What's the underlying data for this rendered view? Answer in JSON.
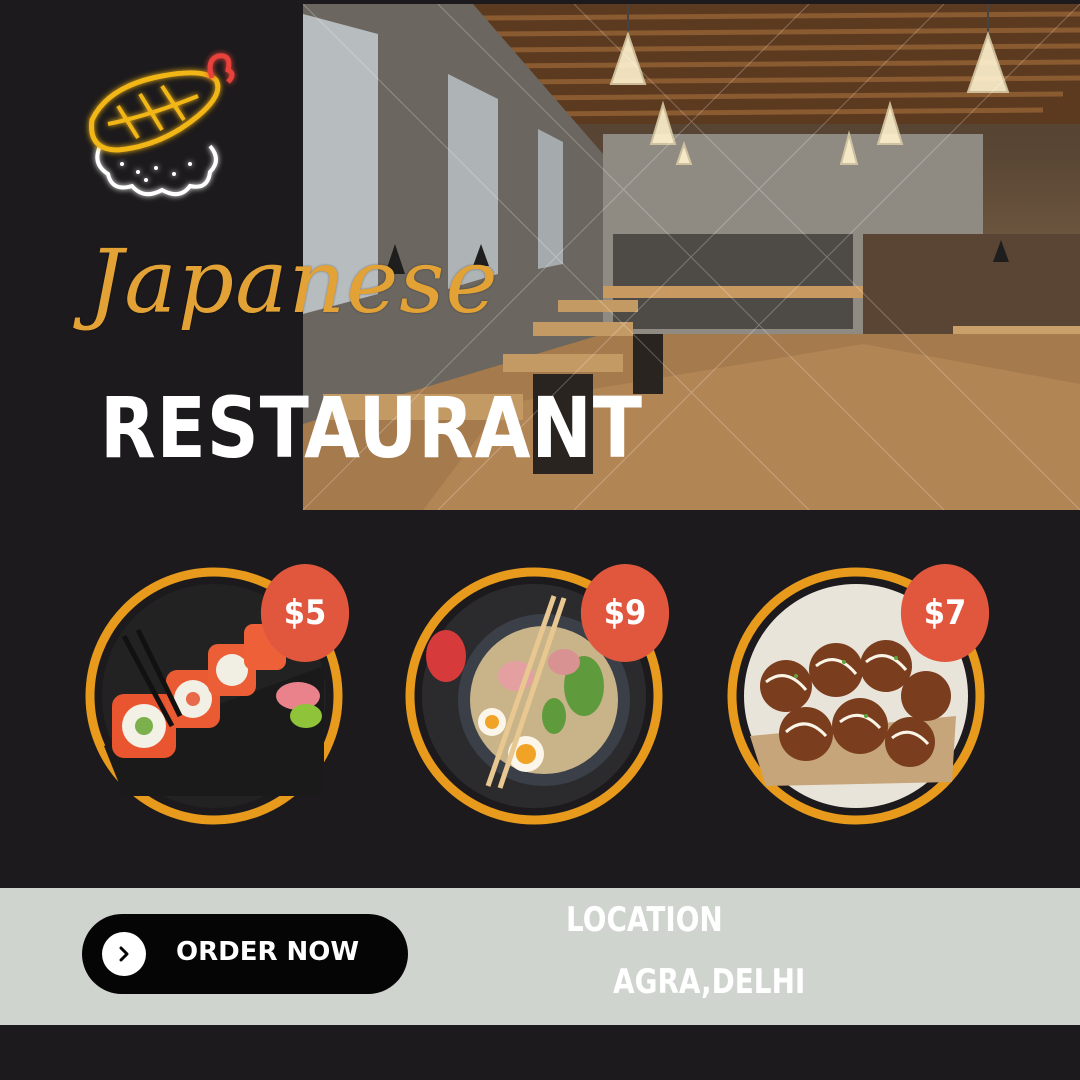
{
  "brand": {
    "title_script": "Japanese",
    "title_main": "RESTAURANT"
  },
  "dishes": [
    {
      "price": "$5",
      "icon": "sushi-roll-photo"
    },
    {
      "price": "$9",
      "icon": "ramen-bowl-photo"
    },
    {
      "price": "$7",
      "icon": "takoyaki-photo"
    }
  ],
  "cta": {
    "label": "ORDER NOW",
    "icon": "chevron-right-icon"
  },
  "location": {
    "label": "LOCATION",
    "value": "AGRA,DELHI"
  },
  "colors": {
    "background": "#1c1a1c",
    "accent_orange": "#e3a235",
    "price_badge": "#e0573d",
    "bottom_bar": "#cfd4cf",
    "button": "#050505"
  }
}
